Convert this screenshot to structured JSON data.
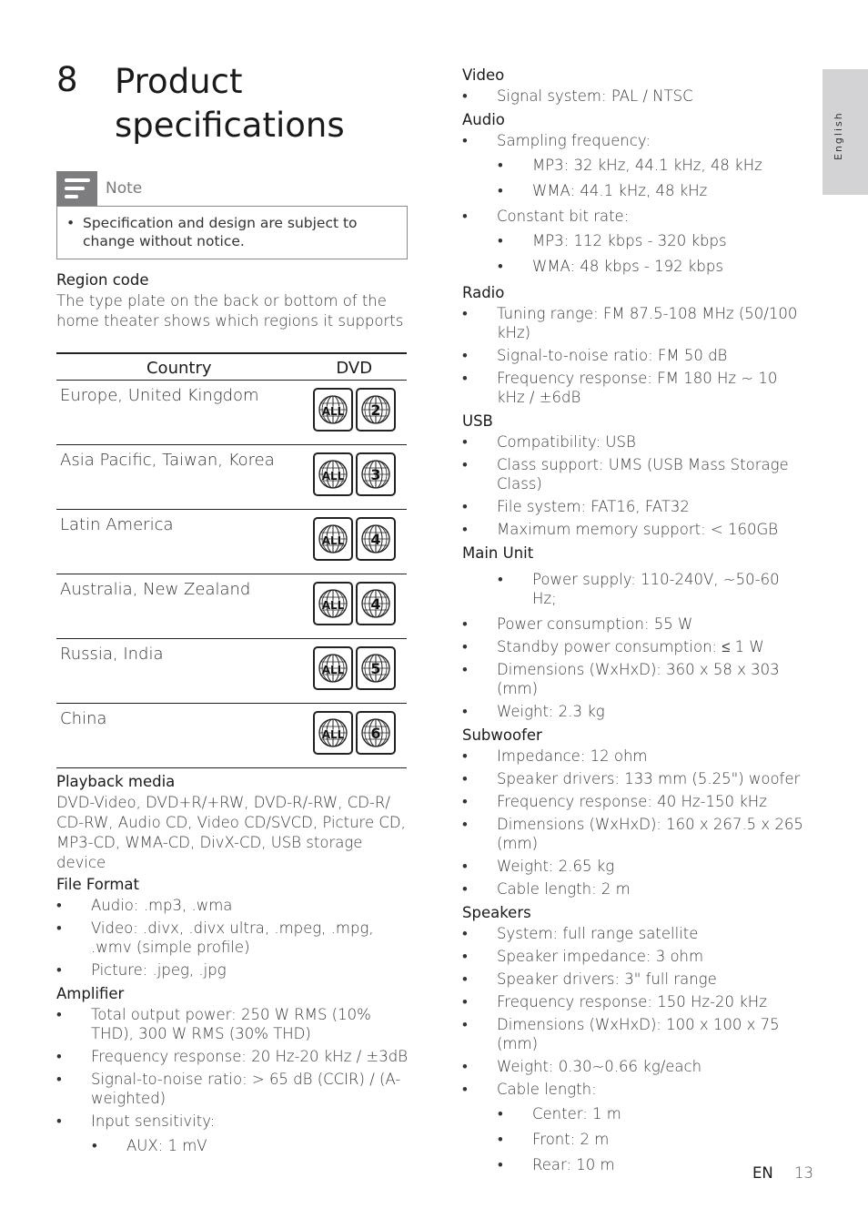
{
  "chapter": {
    "number": "8",
    "title": "Product specifications"
  },
  "note": {
    "label": "Note",
    "bullet": "Specification and design are subject to change without notice."
  },
  "region_code": {
    "heading": "Region code",
    "text": "The type plate on the back or bottom of the home theater shows which regions it supports",
    "table": {
      "headers": [
        "Country",
        "DVD"
      ],
      "rows": [
        {
          "country": "Europe, United Kingdom",
          "badges": [
            "ALL",
            "2"
          ]
        },
        {
          "country": "Asia Pacific, Taiwan, Korea",
          "badges": [
            "ALL",
            "3"
          ]
        },
        {
          "country": "Latin America",
          "badges": [
            "ALL",
            "4"
          ]
        },
        {
          "country": "Australia, New Zealand",
          "badges": [
            "ALL",
            "4"
          ]
        },
        {
          "country": "Russia, India",
          "badges": [
            "ALL",
            "5"
          ]
        },
        {
          "country": "China",
          "badges": [
            "ALL",
            "6"
          ]
        }
      ]
    }
  },
  "playback_media": {
    "heading": "Playback media",
    "text": "DVD-Video, DVD+R/+RW, DVD-R/-RW, CD-R/ CD-RW, Audio CD, Video CD/SVCD, Picture CD, MP3-CD, WMA-CD, DivX-CD, USB storage device"
  },
  "sections_left": [
    {
      "heading": "File Format",
      "items": [
        {
          "text": "Audio: .mp3, .wma"
        },
        {
          "text": "Video: .divx, .divx ultra, .mpeg, .mpg, .wmv (simple profile)"
        },
        {
          "text": "Picture: .jpeg, .jpg"
        }
      ]
    },
    {
      "heading": "Amplifier",
      "items": [
        {
          "text": "Total output power: 250 W RMS (10% THD), 300 W RMS (30% THD)"
        },
        {
          "text": "Frequency response: 20 Hz-20 kHz / ±3dB"
        },
        {
          "text": "Signal-to-noise ratio: > 65 dB (CCIR) / (A-weighted)"
        },
        {
          "text": "Input sensitivity:"
        },
        {
          "text": "AUX: 1 mV",
          "sub": true
        }
      ]
    }
  ],
  "sections_right": [
    {
      "heading": "Video",
      "items": [
        {
          "text": "Signal system: PAL / NTSC"
        }
      ]
    },
    {
      "heading": "Audio",
      "items": [
        {
          "text": "Sampling frequency:"
        },
        {
          "text": "MP3: 32 kHz, 44.1 kHz, 48 kHz",
          "sub": true
        },
        {
          "text": "WMA: 44.1 kHz, 48 kHz",
          "sub": true
        },
        {
          "text": "Constant bit rate:"
        },
        {
          "text": "MP3: 112 kbps - 320 kbps",
          "sub": true
        },
        {
          "text": "WMA: 48 kbps - 192 kbps",
          "sub": true
        }
      ]
    },
    {
      "heading": "Radio",
      "items": [
        {
          "text": "Tuning range: FM 87.5-108 MHz (50/100 kHz)"
        },
        {
          "text": "Signal-to-noise ratio: FM 50 dB"
        },
        {
          "text": "Frequency response: FM 180 Hz ~ 10 kHz / ±6dB"
        }
      ]
    },
    {
      "heading": "USB",
      "items": [
        {
          "text": "Compatibility: USB"
        },
        {
          "text": "Class support: UMS (USB Mass Storage Class)"
        },
        {
          "text": "File system: FAT16, FAT32"
        },
        {
          "text": "Maximum memory support: < 160GB"
        }
      ]
    },
    {
      "heading": "Main Unit",
      "items": [
        {
          "text": "Power supply: 110-240V, ~50-60 Hz;",
          "sub": true
        },
        {
          "text": "Power consumption: 55 W"
        },
        {
          "text": "Standby power consumption: ≤ 1 W"
        },
        {
          "text": "Dimensions (WxHxD): 360 x 58 x 303 (mm)"
        },
        {
          "text": "Weight: 2.3 kg"
        }
      ]
    },
    {
      "heading": "Subwoofer",
      "items": [
        {
          "text": "Impedance: 12 ohm"
        },
        {
          "text": "Speaker drivers: 133 mm (5.25\") woofer"
        },
        {
          "text": "Frequency response: 40 Hz-150 kHz"
        },
        {
          "text": "Dimensions (WxHxD): 160 x 267.5 x 265 (mm)"
        },
        {
          "text": "Weight: 2.65 kg"
        },
        {
          "text": "Cable length: 2 m"
        }
      ]
    },
    {
      "heading": "Speakers",
      "items": [
        {
          "text": "System: full range satellite"
        },
        {
          "text": "Speaker impedance: 3 ohm"
        },
        {
          "text": "Speaker drivers: 3\" full range"
        },
        {
          "text": "Frequency response: 150 Hz-20 kHz"
        },
        {
          "text": "Dimensions (WxHxD): 100 x 100 x 75 (mm)"
        },
        {
          "text": "Weight: 0.30~0.66 kg/each"
        },
        {
          "text": "Cable length:"
        },
        {
          "text": "Center: 1 m",
          "sub": true
        },
        {
          "text": "Front: 2 m",
          "sub": true
        },
        {
          "text": "Rear: 10 m",
          "sub": true
        }
      ]
    }
  ],
  "language_tab": "English",
  "footer": {
    "lang": "EN",
    "page": "13"
  }
}
